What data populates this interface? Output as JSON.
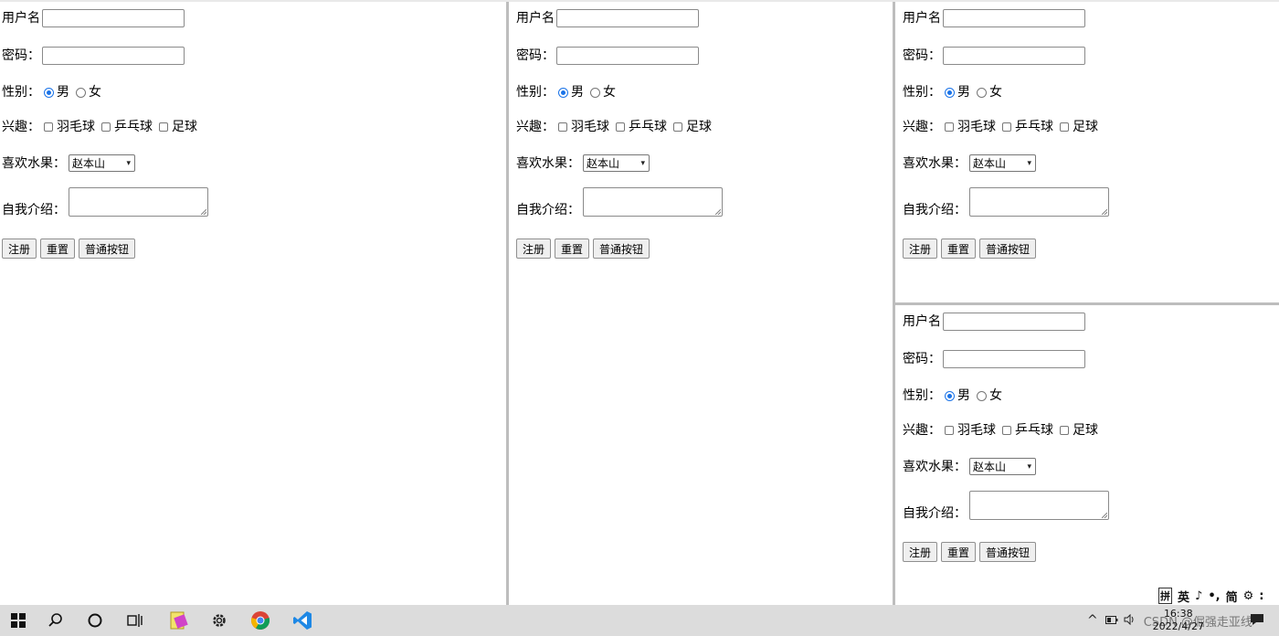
{
  "form": {
    "username_label": "用户名",
    "password_label": "密码：",
    "gender_label": "性别：",
    "gender_options": [
      "男",
      "女"
    ],
    "hobby_label": "兴趣：",
    "hobby_options": [
      "羽毛球",
      "乒乓球",
      "足球"
    ],
    "fruit_label": "喜欢水果：",
    "fruit_selected": "赵本山",
    "intro_label": "自我介绍：",
    "buttons": [
      "注册",
      "重置",
      "普通按钮"
    ]
  },
  "taskbar": {
    "icons": [
      "windows-start-icon",
      "search-icon",
      "cortana-icon",
      "task-view-icon",
      "file-app-icon",
      "settings-gear-icon",
      "chrome-icon",
      "vscode-icon"
    ],
    "tray_up_arrow": "^",
    "time": "16:38",
    "date": "2022/4/27",
    "watermark": "CSDN @倔强走亚线"
  },
  "ime": {
    "items": [
      "拼",
      "英",
      "♪",
      "•,",
      "简",
      "⚙",
      ":"
    ]
  }
}
